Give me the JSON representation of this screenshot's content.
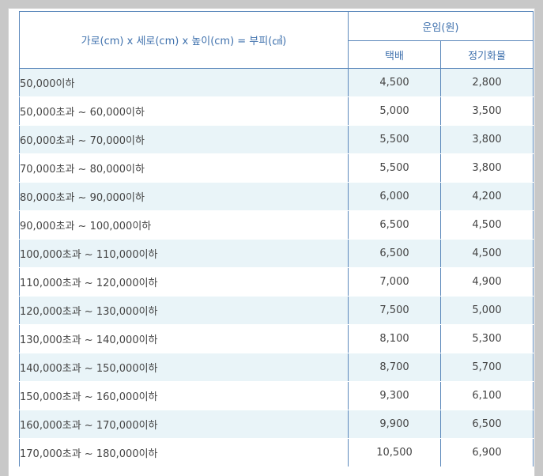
{
  "header": {
    "dimension_label": "가로(cm) x 세로(cm) x 높이(cm) = 부피(㎤)",
    "fare_label": "운임(원)",
    "courier_label": "택배",
    "cargo_label": "정기화물"
  },
  "rows": [
    {
      "range": "50,000이하",
      "courier": "4,500",
      "cargo": "2,800"
    },
    {
      "range": "50,000초과 ~ 60,000이하",
      "courier": "5,000",
      "cargo": "3,500"
    },
    {
      "range": "60,000초과 ~ 70,000이하",
      "courier": "5,500",
      "cargo": "3,800"
    },
    {
      "range": "70,000초과 ~ 80,000이하",
      "courier": "5,500",
      "cargo": "3,800"
    },
    {
      "range": "80,000초과 ~ 90,000이하",
      "courier": "6,000",
      "cargo": "4,200"
    },
    {
      "range": "90,000초과 ~ 100,000이하",
      "courier": "6,500",
      "cargo": "4,500"
    },
    {
      "range": "100,000초과 ~ 110,000이하",
      "courier": "6,500",
      "cargo": "4,500"
    },
    {
      "range": "110,000초과 ~ 120,000이하",
      "courier": "7,000",
      "cargo": "4,900"
    },
    {
      "range": "120,000초과 ~ 130,000이하",
      "courier": "7,500",
      "cargo": "5,000"
    },
    {
      "range": "130,000초과 ~ 140,000이하",
      "courier": "8,100",
      "cargo": "5,300"
    },
    {
      "range": "140,000초과 ~ 150,000이하",
      "courier": "8,700",
      "cargo": "5,700"
    },
    {
      "range": "150,000초과 ~ 160,000이하",
      "courier": "9,300",
      "cargo": "6,100"
    },
    {
      "range": "160,000초과 ~ 170,000이하",
      "courier": "9,900",
      "cargo": "6,500"
    },
    {
      "range": "170,000초과 ~ 180,000이하",
      "courier": "10,500",
      "cargo": "6,900"
    }
  ]
}
